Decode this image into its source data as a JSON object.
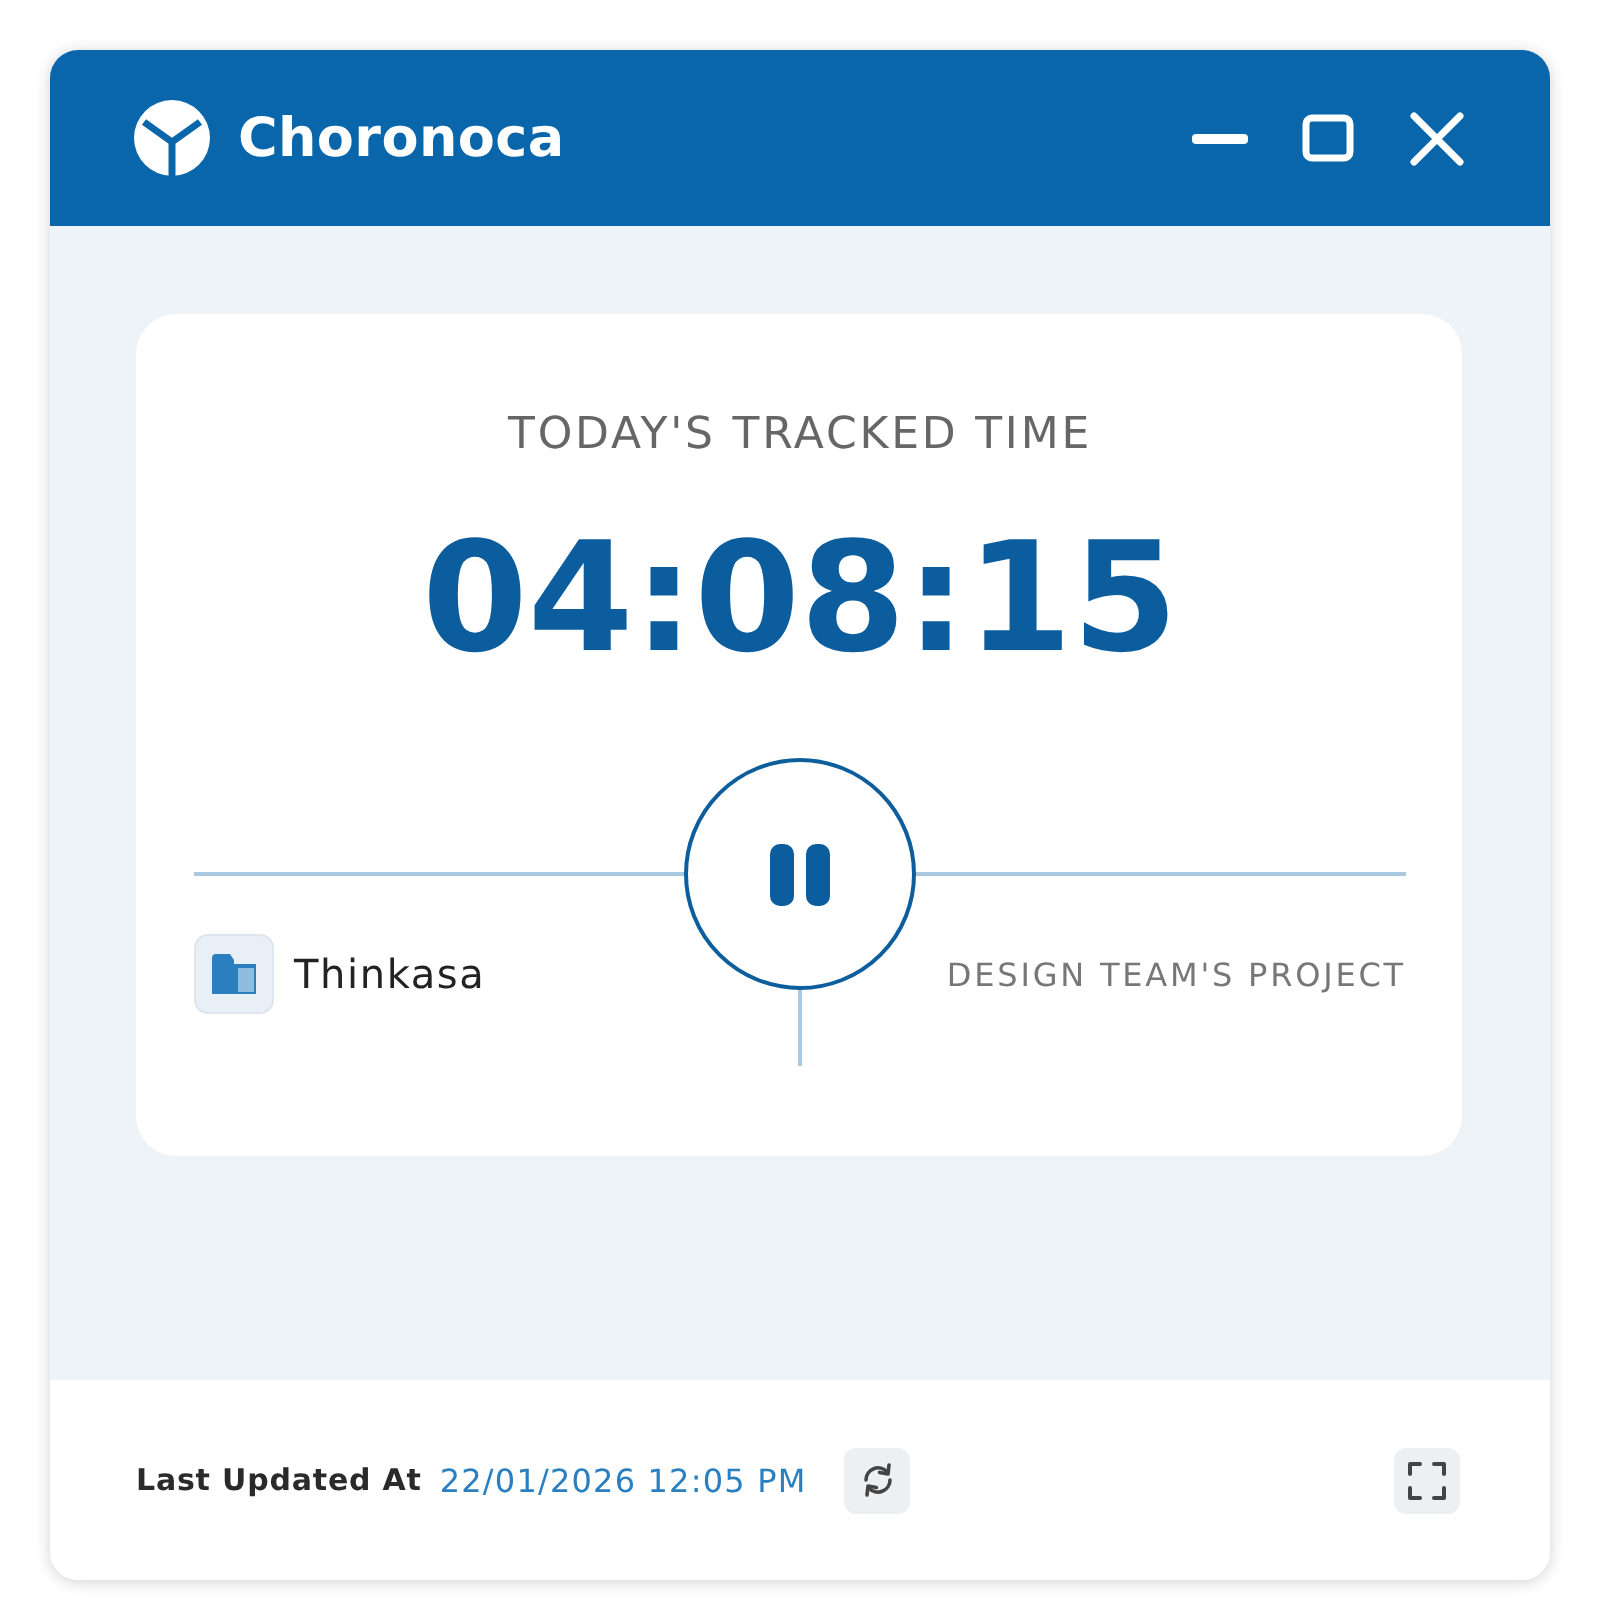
{
  "window": {
    "title": "Choronoca"
  },
  "tracker": {
    "heading": "TODAY'S TRACKED TIME",
    "time": "04:08:15",
    "running": true,
    "client": "Thinkasa",
    "project": "DESIGN TEAM'S PROJECT"
  },
  "footer": {
    "label": "Last Updated At",
    "timestamp": "22/01/2026 12:05 PM"
  }
}
